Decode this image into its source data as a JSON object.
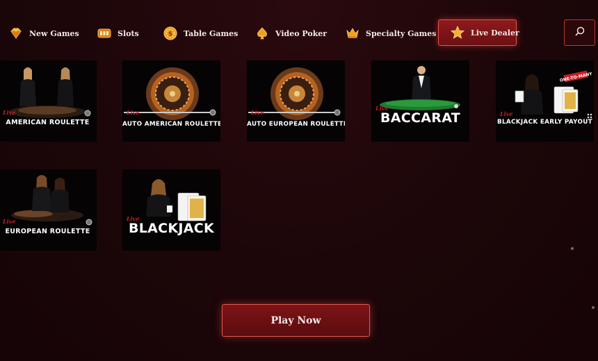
{
  "nav": {
    "items": [
      {
        "label": "New Games",
        "icon": "diamond-icon",
        "active": false
      },
      {
        "label": "Slots",
        "icon": "slot-machine-icon",
        "active": false
      },
      {
        "label": "Table Games",
        "icon": "chip-icon",
        "active": false
      },
      {
        "label": "Video Poker",
        "icon": "spade-icon",
        "active": false
      },
      {
        "label": "Specialty Games",
        "icon": "crown-icon",
        "active": false
      },
      {
        "label": "Live Dealer",
        "icon": "star-icon",
        "active": true
      }
    ],
    "search_icon": "search-icon"
  },
  "games": [
    {
      "live": "Live",
      "title": "AMERICAN ROULETTE"
    },
    {
      "live": "Live",
      "title": "AUTO AMERICAN ROULETTE"
    },
    {
      "live": "Live",
      "title": "AUTO EUROPEAN ROULETTE"
    },
    {
      "live": "Live",
      "title": "BACCARAT"
    },
    {
      "live": "Live",
      "title": "BLACKJACK EARLY PAYOUT",
      "badge": "ONE-TO-MANY"
    },
    {
      "live": "Live",
      "title": "EUROPEAN ROULETTE"
    },
    {
      "live": "Live",
      "title": "BLACKJACK"
    }
  ],
  "play_button": {
    "label": "Play Now"
  },
  "colors": {
    "accent": "#e0574f",
    "background": "#1a0608",
    "live_red": "#c81e24"
  }
}
